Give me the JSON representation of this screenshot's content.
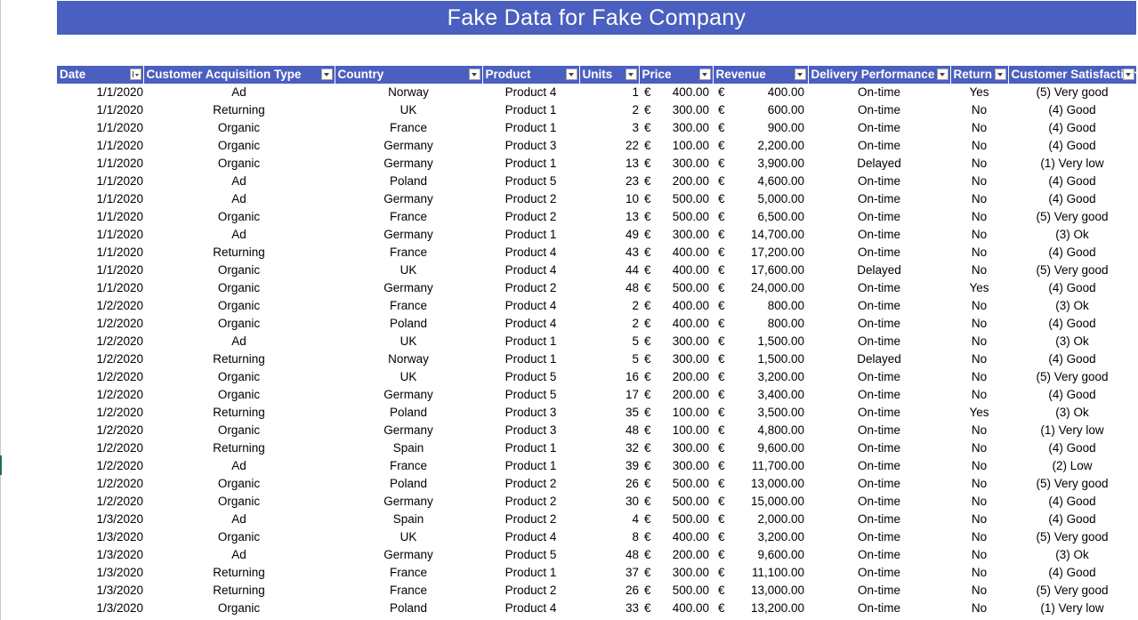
{
  "title": "Fake Data for Fake Company",
  "currency_symbol": "€",
  "columns": [
    "Date",
    "Customer Acquisition Type",
    "Country",
    "Product",
    "Units",
    "Price",
    "Revenue",
    "Delivery Performance",
    "Return",
    "Customer Satisfaction"
  ],
  "sorted_column": "Date",
  "rows": [
    [
      "1/1/2020",
      "Ad",
      "Norway",
      "Product 4",
      "1",
      "400.00",
      "400.00",
      "On-time",
      "Yes",
      "(5) Very good"
    ],
    [
      "1/1/2020",
      "Returning",
      "UK",
      "Product 1",
      "2",
      "300.00",
      "600.00",
      "On-time",
      "No",
      "(4) Good"
    ],
    [
      "1/1/2020",
      "Organic",
      "France",
      "Product 1",
      "3",
      "300.00",
      "900.00",
      "On-time",
      "No",
      "(4) Good"
    ],
    [
      "1/1/2020",
      "Organic",
      "Germany",
      "Product 3",
      "22",
      "100.00",
      "2,200.00",
      "On-time",
      "No",
      "(4) Good"
    ],
    [
      "1/1/2020",
      "Organic",
      "Germany",
      "Product 1",
      "13",
      "300.00",
      "3,900.00",
      "Delayed",
      "No",
      "(1) Very low"
    ],
    [
      "1/1/2020",
      "Ad",
      "Poland",
      "Product 5",
      "23",
      "200.00",
      "4,600.00",
      "On-time",
      "No",
      "(4) Good"
    ],
    [
      "1/1/2020",
      "Ad",
      "Germany",
      "Product 2",
      "10",
      "500.00",
      "5,000.00",
      "On-time",
      "No",
      "(4) Good"
    ],
    [
      "1/1/2020",
      "Organic",
      "France",
      "Product 2",
      "13",
      "500.00",
      "6,500.00",
      "On-time",
      "No",
      "(5) Very good"
    ],
    [
      "1/1/2020",
      "Ad",
      "Germany",
      "Product 1",
      "49",
      "300.00",
      "14,700.00",
      "On-time",
      "No",
      "(3) Ok"
    ],
    [
      "1/1/2020",
      "Returning",
      "France",
      "Product 4",
      "43",
      "400.00",
      "17,200.00",
      "On-time",
      "No",
      "(4) Good"
    ],
    [
      "1/1/2020",
      "Organic",
      "UK",
      "Product 4",
      "44",
      "400.00",
      "17,600.00",
      "Delayed",
      "No",
      "(5) Very good"
    ],
    [
      "1/1/2020",
      "Organic",
      "Germany",
      "Product 2",
      "48",
      "500.00",
      "24,000.00",
      "On-time",
      "Yes",
      "(4) Good"
    ],
    [
      "1/2/2020",
      "Organic",
      "France",
      "Product 4",
      "2",
      "400.00",
      "800.00",
      "On-time",
      "No",
      "(3) Ok"
    ],
    [
      "1/2/2020",
      "Organic",
      "Poland",
      "Product 4",
      "2",
      "400.00",
      "800.00",
      "On-time",
      "No",
      "(4) Good"
    ],
    [
      "1/2/2020",
      "Ad",
      "UK",
      "Product 1",
      "5",
      "300.00",
      "1,500.00",
      "On-time",
      "No",
      "(3) Ok"
    ],
    [
      "1/2/2020",
      "Returning",
      "Norway",
      "Product 1",
      "5",
      "300.00",
      "1,500.00",
      "Delayed",
      "No",
      "(4) Good"
    ],
    [
      "1/2/2020",
      "Organic",
      "UK",
      "Product 5",
      "16",
      "200.00",
      "3,200.00",
      "On-time",
      "No",
      "(5) Very good"
    ],
    [
      "1/2/2020",
      "Organic",
      "Germany",
      "Product 5",
      "17",
      "200.00",
      "3,400.00",
      "On-time",
      "No",
      "(4) Good"
    ],
    [
      "1/2/2020",
      "Returning",
      "Poland",
      "Product 3",
      "35",
      "100.00",
      "3,500.00",
      "On-time",
      "Yes",
      "(3) Ok"
    ],
    [
      "1/2/2020",
      "Organic",
      "Germany",
      "Product 3",
      "48",
      "100.00",
      "4,800.00",
      "On-time",
      "No",
      "(1) Very low"
    ],
    [
      "1/2/2020",
      "Returning",
      "Spain",
      "Product 1",
      "32",
      "300.00",
      "9,600.00",
      "On-time",
      "No",
      "(4) Good"
    ],
    [
      "1/2/2020",
      "Ad",
      "France",
      "Product 1",
      "39",
      "300.00",
      "11,700.00",
      "On-time",
      "No",
      "(2) Low"
    ],
    [
      "1/2/2020",
      "Organic",
      "Poland",
      "Product 2",
      "26",
      "500.00",
      "13,000.00",
      "On-time",
      "No",
      "(5) Very good"
    ],
    [
      "1/2/2020",
      "Organic",
      "Germany",
      "Product 2",
      "30",
      "500.00",
      "15,000.00",
      "On-time",
      "No",
      "(4) Good"
    ],
    [
      "1/3/2020",
      "Ad",
      "Spain",
      "Product 2",
      "4",
      "500.00",
      "2,000.00",
      "On-time",
      "No",
      "(4) Good"
    ],
    [
      "1/3/2020",
      "Organic",
      "UK",
      "Product 4",
      "8",
      "400.00",
      "3,200.00",
      "On-time",
      "No",
      "(5) Very good"
    ],
    [
      "1/3/2020",
      "Ad",
      "Germany",
      "Product 5",
      "48",
      "200.00",
      "9,600.00",
      "On-time",
      "No",
      "(3) Ok"
    ],
    [
      "1/3/2020",
      "Returning",
      "France",
      "Product 1",
      "37",
      "300.00",
      "11,100.00",
      "On-time",
      "No",
      "(4) Good"
    ],
    [
      "1/3/2020",
      "Returning",
      "France",
      "Product 2",
      "26",
      "500.00",
      "13,000.00",
      "On-time",
      "No",
      "(5) Very good"
    ],
    [
      "1/3/2020",
      "Organic",
      "Poland",
      "Product 4",
      "33",
      "400.00",
      "13,200.00",
      "On-time",
      "No",
      "(1) Very low"
    ]
  ]
}
